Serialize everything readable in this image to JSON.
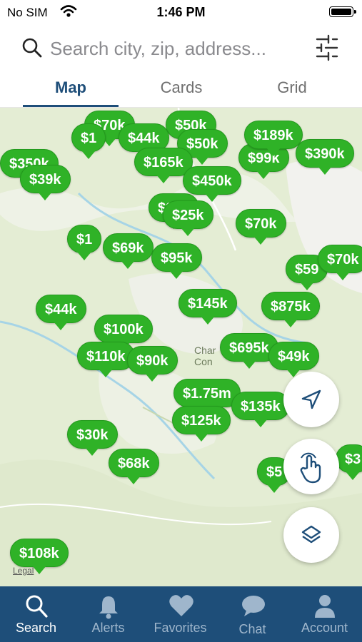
{
  "status": {
    "carrier": "No SIM",
    "time": "1:46 PM"
  },
  "search": {
    "placeholder": "Search city, zip, address..."
  },
  "tabs": [
    {
      "label": "Map",
      "active": true
    },
    {
      "label": "Cards"
    },
    {
      "label": "Grid"
    }
  ],
  "map": {
    "label": "Char\nCon",
    "legal": "Legal",
    "pins": [
      "$70k",
      "$44k",
      "$50k",
      "$189k",
      "$350k",
      "$39k",
      "$165k",
      "$390k",
      "$450k",
      "$25k",
      "$70k",
      "$69k",
      "$95k",
      "$59",
      "$70k",
      "$145k",
      "$875k",
      "$44k",
      "$100k",
      "$695k",
      "$49k",
      "$110k",
      "$90k",
      "$1.75m",
      "$135k",
      "$125k",
      "$30k",
      "$68k",
      "$5",
      "$3",
      "$108k",
      "$99k",
      "$1"
    ],
    "pin_color": "#2fb227"
  },
  "fabs": {
    "locate": "location-arrow-icon",
    "draw": "hand-draw-icon",
    "layers": "layers-icon"
  },
  "tabbar": {
    "items": [
      {
        "label": "Search",
        "active": true
      },
      {
        "label": "Alerts"
      },
      {
        "label": "Favorites"
      },
      {
        "label": "Chat"
      },
      {
        "label": "Account"
      }
    ],
    "bg_color": "#1e4e79"
  }
}
